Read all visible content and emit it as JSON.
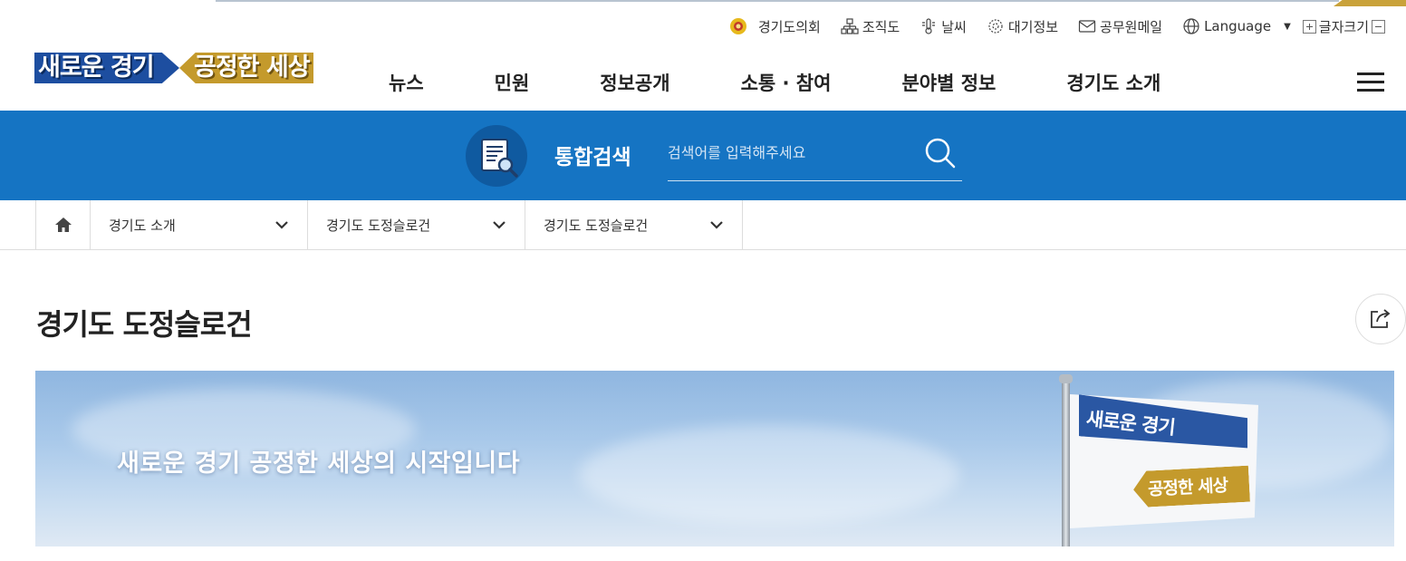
{
  "utility_bar": {
    "council": "경기도의회",
    "org_chart": "조직도",
    "weather": "날씨",
    "air_quality": "대기정보",
    "staff_mail": "공무원메일",
    "language": "Language",
    "font_size": "글자크기"
  },
  "logo": {
    "part1": "새로운 경기",
    "part2": "공정한 세상"
  },
  "gnb": [
    "뉴스",
    "민원",
    "정보공개",
    "소통 · 참여",
    "분야별 정보",
    "경기도 소개"
  ],
  "search": {
    "title": "통합검색",
    "placeholder": "검색어를 입력해주세요"
  },
  "breadcrumb": [
    "경기도 소개",
    "경기도 도정슬로건",
    "경기도 도정슬로건"
  ],
  "page_title": "경기도 도정슬로건",
  "banner": {
    "text": "새로운 경기 공정한 세상의 시작입니다",
    "flag_top": "새로운 경기",
    "flag_bottom": "공정한 세상"
  },
  "colors": {
    "search_band": "#1574c3",
    "logo_blue": "#1d4ea0",
    "logo_gold": "#c49a2c"
  }
}
